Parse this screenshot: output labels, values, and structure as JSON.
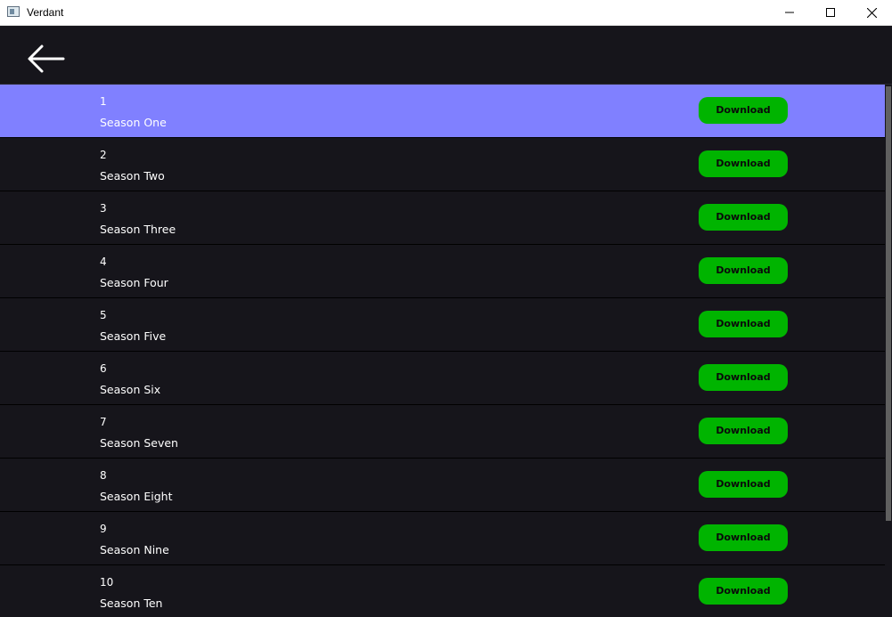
{
  "window": {
    "title": "Verdant"
  },
  "header": {
    "back_icon": "arrow-left-icon"
  },
  "seasons": [
    {
      "number": "1",
      "title": "Season One",
      "button": "Download",
      "selected": true
    },
    {
      "number": "2",
      "title": "Season Two",
      "button": "Download",
      "selected": false
    },
    {
      "number": "3",
      "title": "Season Three",
      "button": "Download",
      "selected": false
    },
    {
      "number": "4",
      "title": "Season Four",
      "button": "Download",
      "selected": false
    },
    {
      "number": "5",
      "title": "Season Five",
      "button": "Download",
      "selected": false
    },
    {
      "number": "6",
      "title": "Season Six",
      "button": "Download",
      "selected": false
    },
    {
      "number": "7",
      "title": "Season Seven",
      "button": "Download",
      "selected": false
    },
    {
      "number": "8",
      "title": "Season Eight",
      "button": "Download",
      "selected": false
    },
    {
      "number": "9",
      "title": "Season Nine",
      "button": "Download",
      "selected": false
    },
    {
      "number": "10",
      "title": "Season Ten",
      "button": "Download",
      "selected": false
    }
  ],
  "colors": {
    "background": "#16151b",
    "selected_row": "#8080ff",
    "download_button": "#00b400",
    "text": "#ffffff"
  }
}
